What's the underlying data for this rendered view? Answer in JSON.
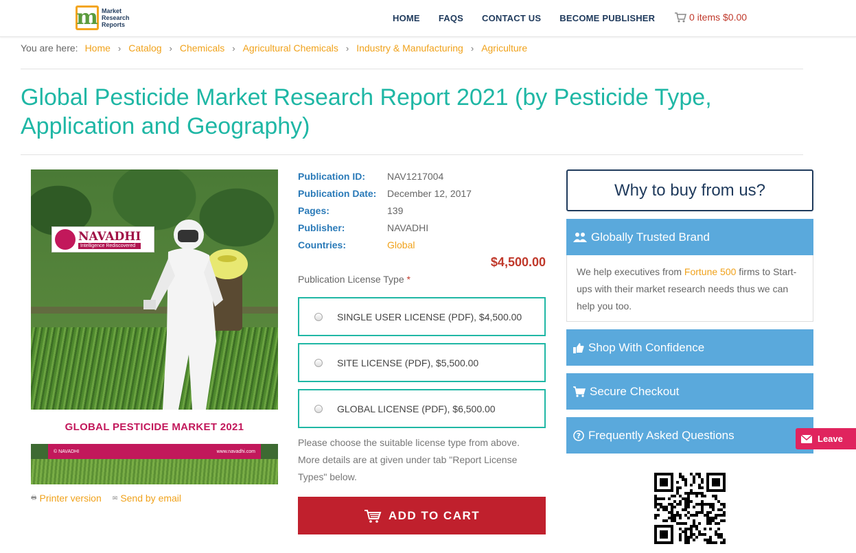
{
  "header": {
    "logo_lines": [
      "Market",
      "Research",
      "Reports"
    ],
    "nav": [
      "HOME",
      "FAQS",
      "CONTACT US",
      "BECOME PUBLISHER"
    ],
    "cart_text": "0 items $0.00"
  },
  "breadcrumb": {
    "label": "You are here:",
    "items": [
      "Home",
      "Catalog",
      "Chemicals",
      "Agricultural Chemicals",
      "Industry & Manufacturing",
      "Agriculture"
    ]
  },
  "title": "Global Pesticide Market Research Report 2021 (by Pesticide Type, Application and Geography)",
  "cover": {
    "brand": "NAVADHI",
    "tagline": "Intelligence Rediscovered",
    "heading": "GLOBAL PESTICIDE MARKET 2021",
    "strip_left": "© NAVADHI",
    "strip_right": "www.navadhi.com"
  },
  "links": {
    "printer": "Printer version",
    "email": "Send by email"
  },
  "meta": [
    {
      "key": "Publication ID:",
      "value": "NAV1217004"
    },
    {
      "key": "Publication Date:",
      "value": "December 12, 2017"
    },
    {
      "key": "Pages:",
      "value": "139"
    },
    {
      "key": "Publisher:",
      "value": "NAVADHI"
    },
    {
      "key": "Countries:",
      "value": "Global"
    }
  ],
  "price": "$4,500.00",
  "license": {
    "label": "Publication License Type",
    "required_mark": "*",
    "options": [
      "SINGLE USER LICENSE (PDF), $4,500.00",
      "SITE LICENSE (PDF), $5,500.00",
      "GLOBAL LICENSE (PDF), $6,500.00"
    ],
    "note": "Please choose the suitable license type from above. More details are at given under tab \"Report License Types\" below."
  },
  "add_to_cart": "ADD TO CART",
  "sidebar": {
    "why": "Why to buy from us?",
    "trusted_title": "Globally Trusted Brand",
    "trusted_pre": "We help executives from ",
    "trusted_hl": "Fortune 500",
    "trusted_post": " firms to Start-ups with their market research needs thus we can help you too.",
    "shop": "Shop With Confidence",
    "secure": "Secure Checkout",
    "faq": "Frequently Asked Questions"
  },
  "leave": "Leave",
  "colors": {
    "teal": "#1fb7a5",
    "orange": "#f0a21b",
    "navy": "#1f3a5c",
    "red": "#c0202d",
    "panel_blue": "#5aa9dc"
  }
}
